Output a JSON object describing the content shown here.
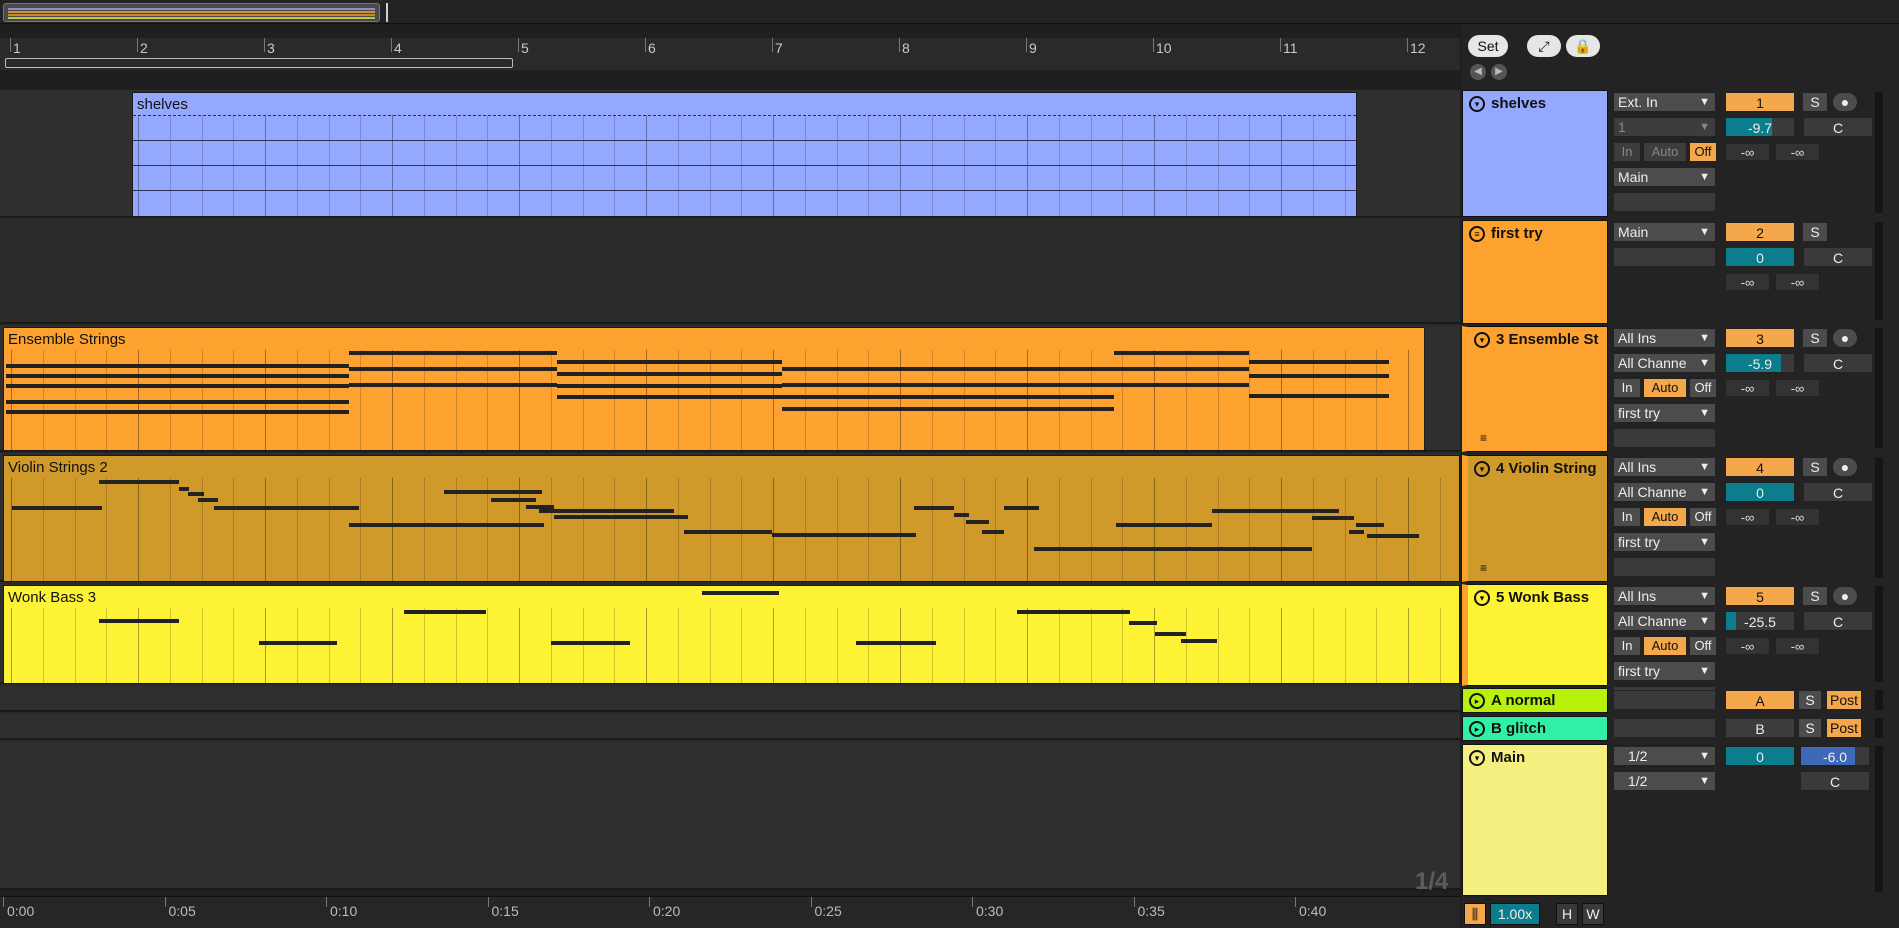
{
  "colors": {
    "shelves": "#95a8ff",
    "first_try": "#fda22f",
    "ensemble": "#fda22f",
    "violin": "#cf9a2a",
    "wonk": "#fef234",
    "a_normal": "#b8f20c",
    "b_glitch": "#2ff0a4",
    "main": "#f4ef7e",
    "accent": "#f4a84b"
  },
  "ruler": {
    "bars": [
      "1",
      "2",
      "3",
      "4",
      "5",
      "6",
      "7",
      "8",
      "9",
      "10",
      "11",
      "12"
    ]
  },
  "time_ruler": {
    "labels": [
      "0:00",
      "0:05",
      "0:10",
      "0:15",
      "0:20",
      "0:25",
      "0:30",
      "0:35",
      "0:40"
    ]
  },
  "zoom_label": "1/4",
  "header_buttons": {
    "set": "Set"
  },
  "clips": [
    {
      "name": "shelves"
    },
    {
      "name": "Ensemble Strings"
    },
    {
      "name": "Violin Strings 2"
    },
    {
      "name": "Wonk Bass 3"
    }
  ],
  "tracks": [
    {
      "name": "shelves",
      "input": "Ext. In",
      "channel": "1",
      "monitor": [
        "In",
        "Auto",
        "Off"
      ],
      "output": "Main",
      "number": "1",
      "solo": "S",
      "volume": "-9.7",
      "pan": "C",
      "peak_l": "-∞",
      "peak_r": "-∞"
    },
    {
      "name": "first try",
      "output": "Main",
      "number": "2",
      "solo": "S",
      "volume": "0",
      "pan": "C",
      "peak_l": "-∞",
      "peak_r": "-∞"
    },
    {
      "name": "3 Ensemble St",
      "input": "All Ins",
      "channel": "All Channe",
      "monitor": [
        "In",
        "Auto",
        "Off"
      ],
      "output": "first try",
      "number": "3",
      "solo": "S",
      "volume": "-5.9",
      "pan": "C",
      "peak_l": "-∞",
      "peak_r": "-∞"
    },
    {
      "name": "4 Violin String",
      "input": "All Ins",
      "channel": "All Channe",
      "monitor": [
        "In",
        "Auto",
        "Off"
      ],
      "output": "first try",
      "number": "4",
      "solo": "S",
      "volume": "0",
      "pan": "C",
      "peak_l": "-∞",
      "peak_r": "-∞"
    },
    {
      "name": "5 Wonk Bass",
      "input": "All Ins",
      "channel": "All Channe",
      "monitor": [
        "In",
        "Auto",
        "Off"
      ],
      "output": "first try",
      "number": "5",
      "solo": "S",
      "volume": "-25.5",
      "pan": "C",
      "peak_l": "-∞",
      "peak_r": "-∞"
    }
  ],
  "returns": [
    {
      "name": "A normal",
      "letter": "A",
      "solo": "S",
      "post": "Post"
    },
    {
      "name": "B glitch",
      "letter": "B",
      "solo": "S",
      "post": "Post"
    }
  ],
  "main": {
    "name": "Main",
    "out1": "1/2",
    "out2": "1/2",
    "volume": "0",
    "cue": "-6.0",
    "pan": "C"
  },
  "bottom": {
    "tempo_scale": "1.00x",
    "h": "H",
    "w": "W"
  }
}
